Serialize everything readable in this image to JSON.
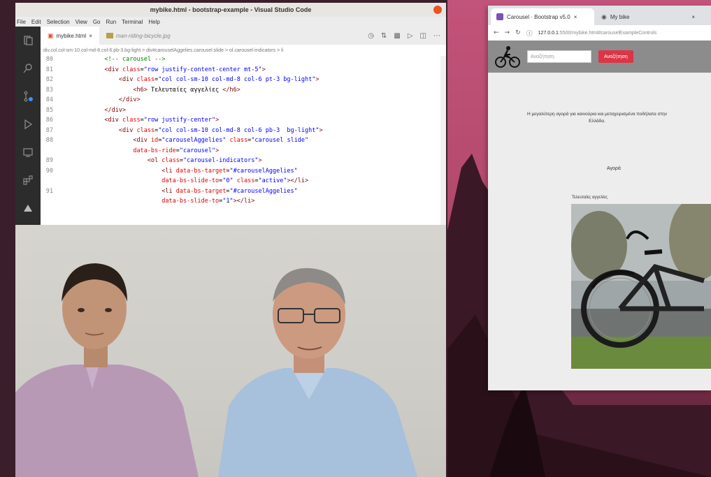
{
  "vscode": {
    "title": "mybike.html - bootstrap-example - Visual Studio Code",
    "menu": [
      "File",
      "Edit",
      "Selection",
      "View",
      "Go",
      "Run",
      "Terminal",
      "Help"
    ],
    "tabs": [
      {
        "label": "mybike.html",
        "active": true
      },
      {
        "label": "man-riding-bicycle.jpg",
        "active": false
      }
    ],
    "breadcrumb": "div.col.col-sm-10.col-md-8.col-6.pb-3.bg-light > div#carouselAggelies.carousel.slide > ol.carousel-indicators > li",
    "code_lines": [
      {
        "n": "80",
        "parts": [
          {
            "t": "            ",
            "c": "text"
          },
          {
            "t": "<!-- carousel -->",
            "c": "com"
          }
        ]
      },
      {
        "n": "81",
        "parts": [
          {
            "t": "            <div ",
            "c": "tag"
          },
          {
            "t": "class",
            "c": "attr"
          },
          {
            "t": "=",
            "c": "text"
          },
          {
            "t": "\"row justify-content-center mt-5\"",
            "c": "str"
          },
          {
            "t": ">",
            "c": "tag"
          }
        ]
      },
      {
        "n": "82",
        "parts": [
          {
            "t": "                <div ",
            "c": "tag"
          },
          {
            "t": "class",
            "c": "attr"
          },
          {
            "t": "=",
            "c": "text"
          },
          {
            "t": "\"col col-sm-10 col-md-8 col-6 pt-3 bg-light\"",
            "c": "str"
          },
          {
            "t": ">",
            "c": "tag"
          }
        ]
      },
      {
        "n": "83",
        "parts": [
          {
            "t": "                    <h6>",
            "c": "tag"
          },
          {
            "t": " Τελευταίες αγγελίες ",
            "c": "text"
          },
          {
            "t": "</h6>",
            "c": "tag"
          }
        ]
      },
      {
        "n": "84",
        "parts": [
          {
            "t": "                </div>",
            "c": "tag"
          }
        ]
      },
      {
        "n": "85",
        "parts": [
          {
            "t": "            </div>",
            "c": "tag"
          }
        ]
      },
      {
        "n": "86",
        "parts": [
          {
            "t": "            <div ",
            "c": "tag"
          },
          {
            "t": "class",
            "c": "attr"
          },
          {
            "t": "=",
            "c": "text"
          },
          {
            "t": "\"row justify-center\"",
            "c": "str"
          },
          {
            "t": ">",
            "c": "tag"
          }
        ]
      },
      {
        "n": "87",
        "parts": [
          {
            "t": "                <div ",
            "c": "tag"
          },
          {
            "t": "class",
            "c": "attr"
          },
          {
            "t": "=",
            "c": "text"
          },
          {
            "t": "\"col col-sm-10 col-md-8 col-6 pb-3  bg-light\"",
            "c": "str"
          },
          {
            "t": ">",
            "c": "tag"
          }
        ]
      },
      {
        "n": "88",
        "parts": [
          {
            "t": "                    <div ",
            "c": "tag"
          },
          {
            "t": "id",
            "c": "attr"
          },
          {
            "t": "=",
            "c": "text"
          },
          {
            "t": "\"carouselAggelies\"",
            "c": "str"
          },
          {
            "t": " class",
            "c": "attr"
          },
          {
            "t": "=",
            "c": "text"
          },
          {
            "t": "\"carousel slide\"",
            "c": "str"
          }
        ]
      },
      {
        "n": "",
        "parts": [
          {
            "t": "                    data-bs-ride",
            "c": "attr"
          },
          {
            "t": "=",
            "c": "text"
          },
          {
            "t": "\"carousel\"",
            "c": "str"
          },
          {
            "t": ">",
            "c": "tag"
          }
        ]
      },
      {
        "n": "89",
        "parts": [
          {
            "t": "                        <ol ",
            "c": "tag"
          },
          {
            "t": "class",
            "c": "attr"
          },
          {
            "t": "=",
            "c": "text"
          },
          {
            "t": "\"carousel-indicators\"",
            "c": "str"
          },
          {
            "t": ">",
            "c": "tag"
          }
        ]
      },
      {
        "n": "90",
        "parts": [
          {
            "t": "                            <li ",
            "c": "tag"
          },
          {
            "t": "data-bs-target",
            "c": "attr"
          },
          {
            "t": "=",
            "c": "text"
          },
          {
            "t": "\"#carouselAggelies\"",
            "c": "str"
          }
        ]
      },
      {
        "n": "",
        "parts": [
          {
            "t": "                            data-bs-slide-to",
            "c": "attr"
          },
          {
            "t": "=",
            "c": "text"
          },
          {
            "t": "\"0\"",
            "c": "str"
          },
          {
            "t": " class",
            "c": "attr"
          },
          {
            "t": "=",
            "c": "text"
          },
          {
            "t": "\"active\"",
            "c": "str"
          },
          {
            "t": "></li>",
            "c": "tag"
          }
        ]
      },
      {
        "n": "91",
        "parts": [
          {
            "t": "                            <li ",
            "c": "tag"
          },
          {
            "t": "data-bs-target",
            "c": "attr"
          },
          {
            "t": "=",
            "c": "text"
          },
          {
            "t": "\"#carouselAggelies\"",
            "c": "str"
          }
        ]
      },
      {
        "n": "",
        "parts": [
          {
            "t": "                            data-bs-slide-to",
            "c": "attr"
          },
          {
            "t": "=",
            "c": "text"
          },
          {
            "t": "\"1\"",
            "c": "str"
          },
          {
            "t": "></li>",
            "c": "tag"
          }
        ]
      }
    ]
  },
  "browser": {
    "tabs": [
      {
        "label": "Carousel · Bootstrap v5.0",
        "active": true
      },
      {
        "label": "My bike",
        "active": false
      }
    ],
    "url_host": "127.0.0.1",
    "url_path": ":5500/mybike.html#carouselExampleControls",
    "site": {
      "search_placeholder": "Αναζήτηση",
      "search_button": "Αναζήτηση",
      "intro": "Η μεγαλύτερη αγορά για καινούρια και μεταχειρισμένα ποδήλατα στην Ελλάδα.",
      "more_button": "Αγορά",
      "carousel_heading": "Τελευταίες αγγελίες"
    }
  },
  "colors": {
    "wallpaper": "#b44a6d",
    "accent_red": "#dc3545",
    "bootstrap_purple": "#7952b3",
    "vscode_orange": "#e95420"
  }
}
